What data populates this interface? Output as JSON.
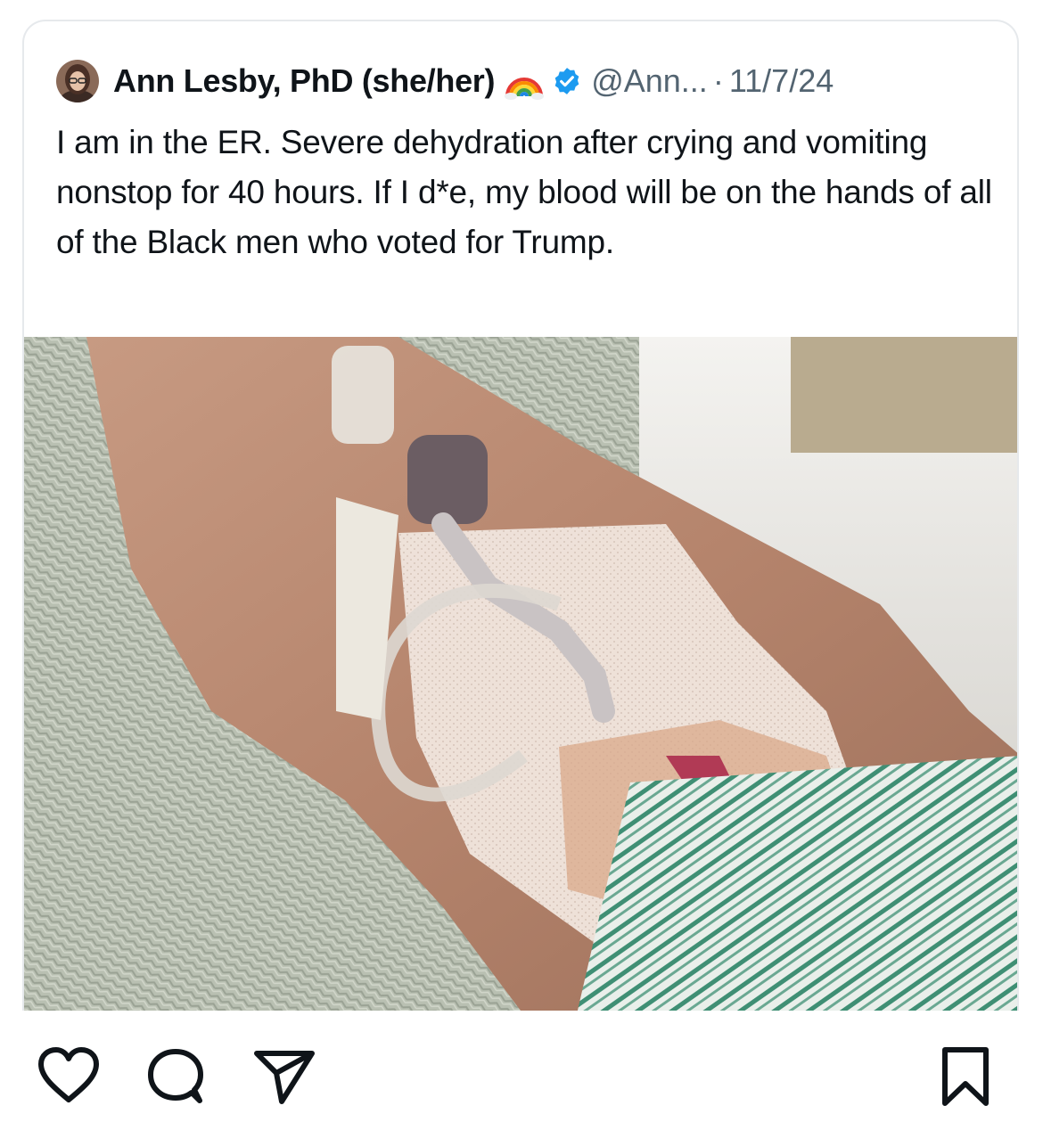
{
  "tweet": {
    "author_name": "Ann Lesby, PhD (she/her)",
    "handle": "@Ann...",
    "separator": "·",
    "date": "11/7/24",
    "text": "I am in the ER. Severe dehydration after crying and vomiting nonstop for 40 hours. If I d*e, my blood will be on the hands of all of the Black men who voted for Trump.",
    "avatar_icon": "profile-photo",
    "emoji_icon": "rainbow-icon",
    "verified_icon": "verified-badge-icon",
    "verified_color": "#1d9bf0"
  },
  "actions": {
    "like_icon": "heart-icon",
    "comment_icon": "comment-bubble-icon",
    "share_icon": "paper-plane-icon",
    "save_icon": "bookmark-icon"
  },
  "colors": {
    "text": "#0f1419",
    "muted": "#536471",
    "card_border": "#e6e9ec"
  }
}
